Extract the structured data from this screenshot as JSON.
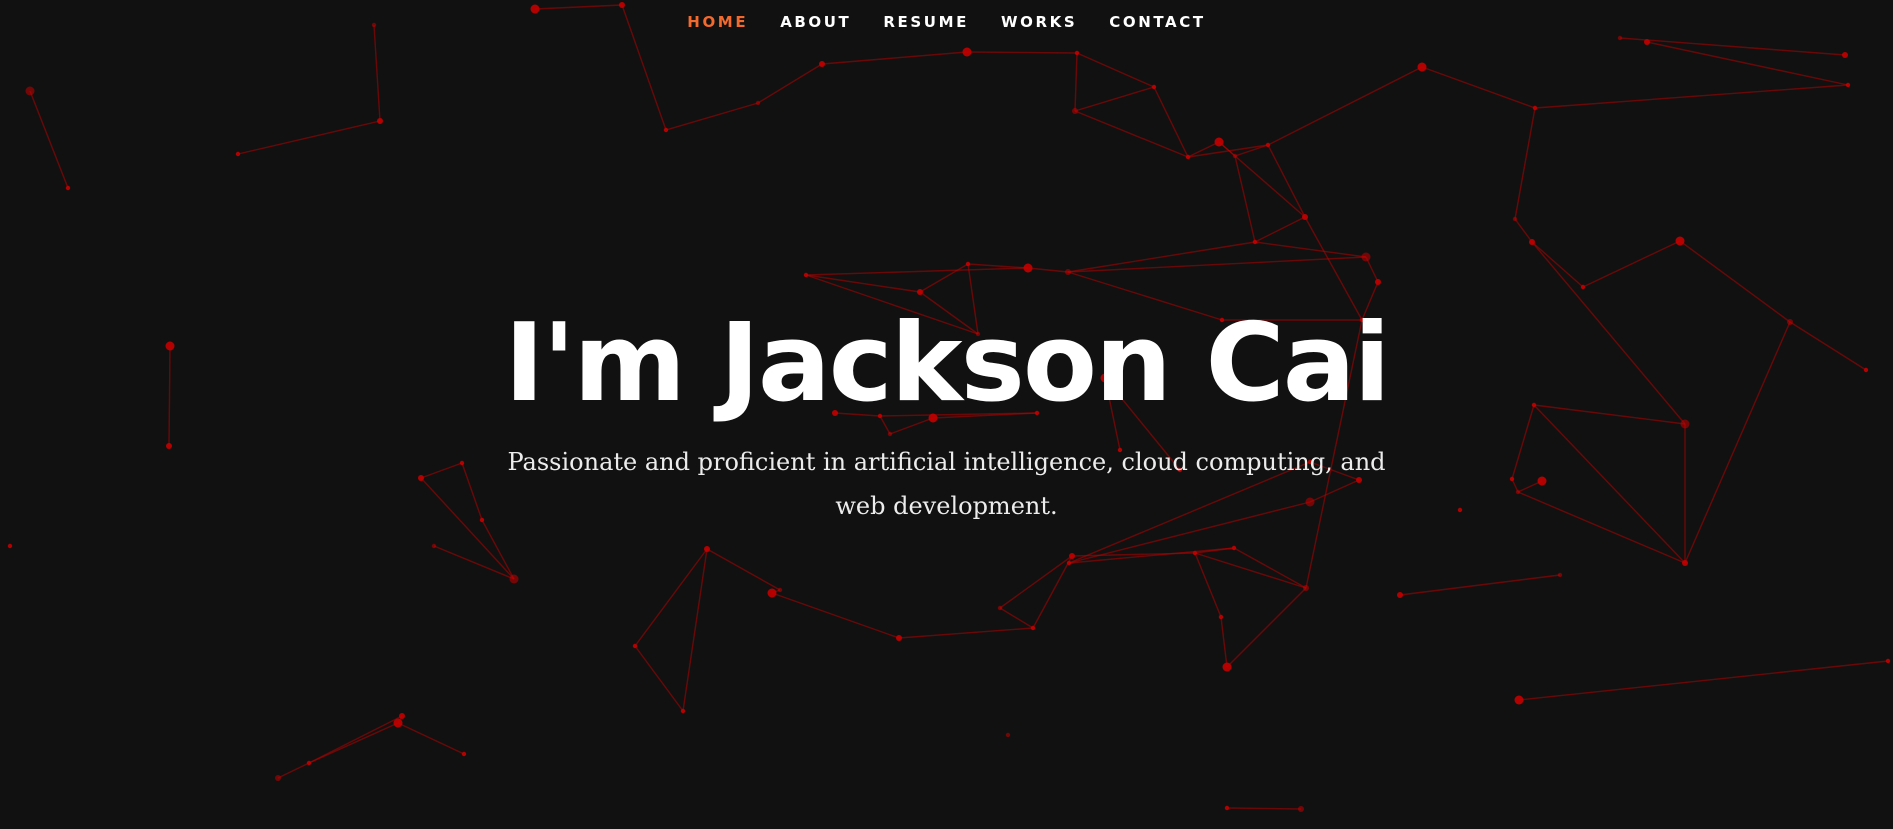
{
  "nav": {
    "items": [
      {
        "label": "HOME",
        "active": true
      },
      {
        "label": "ABOUT",
        "active": false
      },
      {
        "label": "RESUME",
        "active": false
      },
      {
        "label": "WORKS",
        "active": false
      },
      {
        "label": "CONTACT",
        "active": false
      }
    ]
  },
  "hero": {
    "title": "I'm Jackson Cai",
    "subtitle": "Passionate and proficient in artificial intelligence, cloud computing, and web development."
  },
  "colors": {
    "background": "#111111",
    "accent": "#f26a2e",
    "network": "#c40000"
  }
}
